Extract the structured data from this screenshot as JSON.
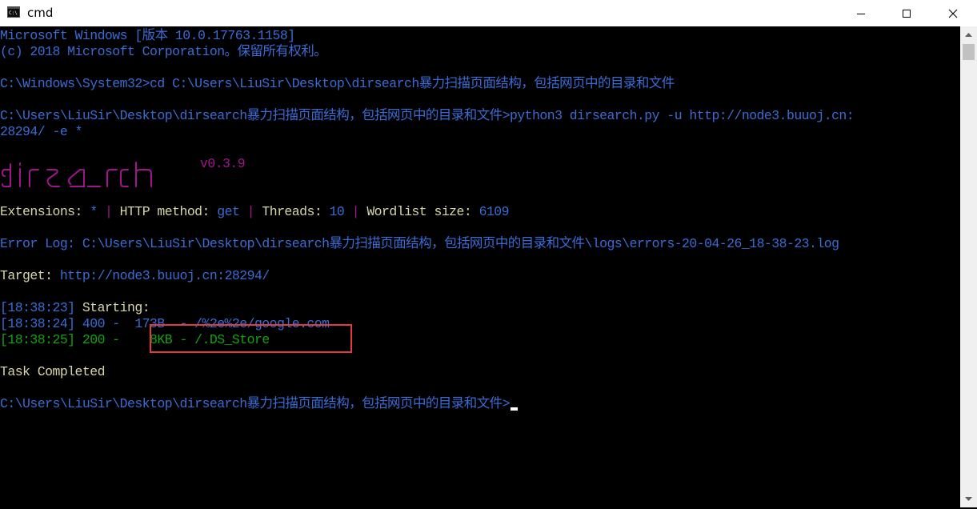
{
  "window": {
    "title": "cmd",
    "icon": "cmd-icon"
  },
  "console": {
    "l1": "Microsoft Windows [版本 10.0.17763.1158]",
    "l2": "(c) 2018 Microsoft Corporation。保留所有权利。",
    "l3": "C:\\Windows\\System32>cd C:\\Users\\LiuSir\\Desktop\\dirsearch暴力扫描页面结构，包括网页中的目录和文件",
    "l4": "C:\\Users\\LiuSir\\Desktop\\dirsearch暴力扫描页面结构，包括网页中的目录和文件>python3 dirsearch.py -u http://node3.buuoj.cn:",
    "l5": "28294/ -e *",
    "version": "v0.3.9",
    "ext_label": "Extensions: ",
    "ext_value": "*",
    "sep": " | ",
    "method_label": "HTTP method: ",
    "method_value": "get",
    "threads_label": "Threads: ",
    "threads_value": "10",
    "wordlist_label": "Wordlist size: ",
    "wordlist_value": "6109",
    "errorlog_label": "Error Log: ",
    "errorlog_value": "C:\\Users\\LiuSir\\Desktop\\dirsearch暴力扫描页面结构，包括网页中的目录和文件\\logs\\errors-20-04-26_18-38-23.log",
    "target_label": "Target: ",
    "target_value": "http://node3.buuoj.cn:28294/",
    "start_time": "[18:38:23] ",
    "start_text": "Starting:",
    "r1": "[18:38:24] 400 -  173B  - /%2e%2e/google.com",
    "r2_prefix": "[18:38:25] 200 -    ",
    "r2_found": "8KB - /.DS_Store",
    "completed": "Task Completed",
    "prompt": "C:\\Users\\LiuSir\\Desktop\\dirsearch暴力扫描页面结构，包括网页中的目录和文件>"
  },
  "colors": {
    "blue": "#3a6cd6",
    "green": "#13a10e",
    "magenta": "#a1168c",
    "yellow": "#d8d6a7",
    "highlight": "#e23b3b"
  }
}
